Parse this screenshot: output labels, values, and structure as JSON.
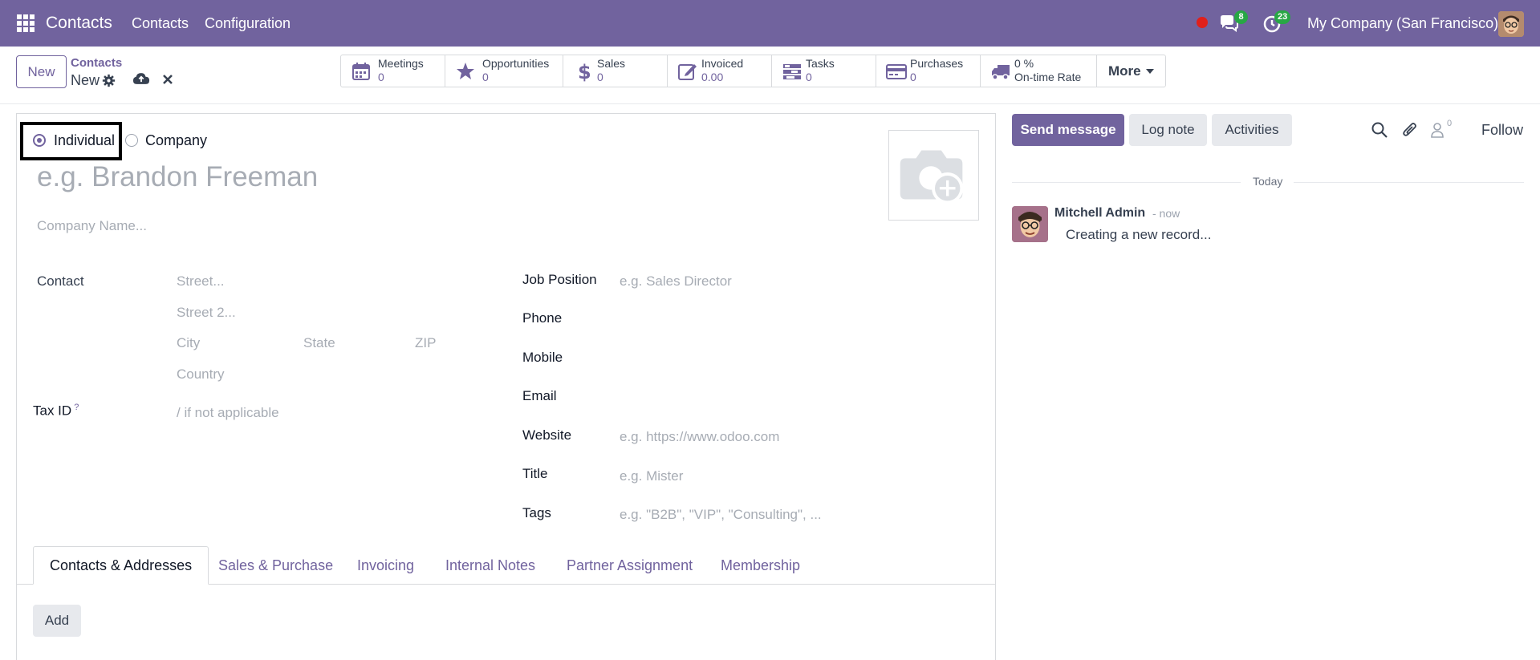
{
  "topbar": {
    "app_name": "Contacts",
    "menu": [
      "Contacts",
      "Configuration"
    ],
    "messages_count": "8",
    "activities_count": "23",
    "company": "My Company (San Francisco)"
  },
  "control": {
    "new_label": "New",
    "breadcrumb_parent": "Contacts",
    "breadcrumb_current": "New",
    "stats": [
      {
        "label": "Meetings",
        "value": "0",
        "icon": "calendar-icon"
      },
      {
        "label": "Opportunities",
        "value": "0",
        "icon": "star-icon"
      },
      {
        "label": "Sales",
        "value": "0",
        "icon": "dollar-icon"
      },
      {
        "label": "Invoiced",
        "value": "0.00",
        "icon": "pencil-square-icon"
      },
      {
        "label": "Tasks",
        "value": "0",
        "icon": "tasks-icon"
      },
      {
        "label": "Purchases",
        "value": "0",
        "icon": "credit-card-icon"
      },
      {
        "label": "0 %",
        "value": "On-time Rate",
        "icon": "truck-icon"
      }
    ],
    "more_label": "More"
  },
  "form": {
    "type_individual": "Individual",
    "type_company": "Company",
    "name_placeholder": "e.g. Brandon Freeman",
    "company_placeholder": "Company Name...",
    "contact_label": "Contact",
    "street_placeholder": "Street...",
    "street2_placeholder": "Street 2...",
    "city_placeholder": "City",
    "state_placeholder": "State",
    "zip_placeholder": "ZIP",
    "country_placeholder": "Country",
    "tax_label": "Tax ID",
    "tax_help": "?",
    "tax_placeholder": "/ if not applicable",
    "job_label": "Job Position",
    "job_placeholder": "e.g. Sales Director",
    "phone_label": "Phone",
    "mobile_label": "Mobile",
    "email_label": "Email",
    "website_label": "Website",
    "website_placeholder": "e.g. https://www.odoo.com",
    "title_label": "Title",
    "title_placeholder": "e.g. Mister",
    "tags_label": "Tags",
    "tags_placeholder": "e.g. \"B2B\", \"VIP\", \"Consulting\", ..."
  },
  "tabs": [
    "Contacts & Addresses",
    "Sales & Purchase",
    "Invoicing",
    "Internal Notes",
    "Partner Assignment",
    "Membership"
  ],
  "add_label": "Add",
  "chatter": {
    "send_message": "Send message",
    "log_note": "Log note",
    "activities": "Activities",
    "followers_count": "0",
    "follow": "Follow",
    "date_separator": "Today",
    "author": "Mitchell Admin",
    "time": "- now",
    "body": "Creating a new record..."
  },
  "colors": {
    "brand": "#71639e",
    "badge": "#28a745",
    "recording": "#e0201b"
  }
}
